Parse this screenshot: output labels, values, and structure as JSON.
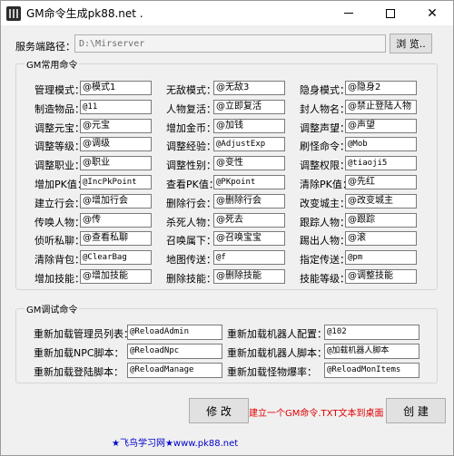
{
  "window": {
    "title": "GM命令生成pk88.net ."
  },
  "server": {
    "label": "服务端路径：",
    "path": "D:\\Mirserver",
    "browse_label": "浏 览.."
  },
  "gm_common": {
    "title": "GM常用命令",
    "rows": [
      [
        {
          "label": "管理模式：",
          "value": "@模式1"
        },
        {
          "label": "无敌模式：",
          "value": "@无敌3"
        },
        {
          "label": "隐身模式：",
          "value": "@隐身2"
        }
      ],
      [
        {
          "label": "制造物品：",
          "value": "@11"
        },
        {
          "label": "人物复活：",
          "value": "@立即复活"
        },
        {
          "label": "封人物名：",
          "value": "@禁止登陆人物"
        }
      ],
      [
        {
          "label": "调整元宝：",
          "value": "@元宝"
        },
        {
          "label": "增加金币：",
          "value": "@加钱"
        },
        {
          "label": "调整声望：",
          "value": "@声望"
        }
      ],
      [
        {
          "label": "调整等级：",
          "value": "@调级"
        },
        {
          "label": "调整经验：",
          "value": "@AdjustExp"
        },
        {
          "label": "刷怪命令：",
          "value": "@Mob"
        }
      ],
      [
        {
          "label": "调整职业：",
          "value": "@职业"
        },
        {
          "label": "调整性别：",
          "value": "@变性"
        },
        {
          "label": "调整权限：",
          "value": "@tiaoji5"
        }
      ],
      [
        {
          "label": "增加PK值：",
          "value": "@IncPkPoint"
        },
        {
          "label": "查看PK值：",
          "value": "@PKpoint"
        },
        {
          "label": "清除PK值：",
          "value": "@先红"
        }
      ],
      [
        {
          "label": "建立行会：",
          "value": "@增加行会"
        },
        {
          "label": "删除行会：",
          "value": "@删除行会"
        },
        {
          "label": "改变城主：",
          "value": "@改变城主"
        }
      ],
      [
        {
          "label": "传唤人物：",
          "value": "@传"
        },
        {
          "label": "杀死人物：",
          "value": "@死去"
        },
        {
          "label": "跟踪人物：",
          "value": "@跟踪"
        }
      ],
      [
        {
          "label": "侦听私聊：",
          "value": "@查看私聊"
        },
        {
          "label": "召唤属下：",
          "value": "@召唤宝宝"
        },
        {
          "label": "踢出人物：",
          "value": "@滚"
        }
      ],
      [
        {
          "label": "清除背包：",
          "value": "@ClearBag"
        },
        {
          "label": "地图传送：",
          "value": "@f"
        },
        {
          "label": "指定传送：",
          "value": "@pm"
        }
      ],
      [
        {
          "label": "增加技能：",
          "value": "@增加技能"
        },
        {
          "label": "删除技能：",
          "value": "@删除技能"
        },
        {
          "label": "技能等级：",
          "value": "@调整技能"
        }
      ]
    ]
  },
  "gm_debug": {
    "title": "GM调试命令",
    "rows": [
      [
        {
          "label": "重新加载管理员列表：",
          "value": "@ReloadAdmin"
        },
        {
          "label": "重新加载机器人配置：",
          "value": "@102"
        }
      ],
      [
        {
          "label": "重新加载NPC脚本：",
          "value": "@ReloadNpc"
        },
        {
          "label": "重新加载机器人脚本：",
          "value": "@加载机器人脚本"
        }
      ],
      [
        {
          "label": "重新加载登陆脚本：",
          "value": "@ReloadManage"
        },
        {
          "label": "重新加载怪物爆率：",
          "value": "@ReloadMonItems"
        }
      ]
    ]
  },
  "actions": {
    "modify_label": "修 改",
    "hint": "建立一个GM命令.TXT文本到桌面",
    "create_label": "创 建",
    "footer": "★飞鸟学习网★www.pk88.net"
  }
}
